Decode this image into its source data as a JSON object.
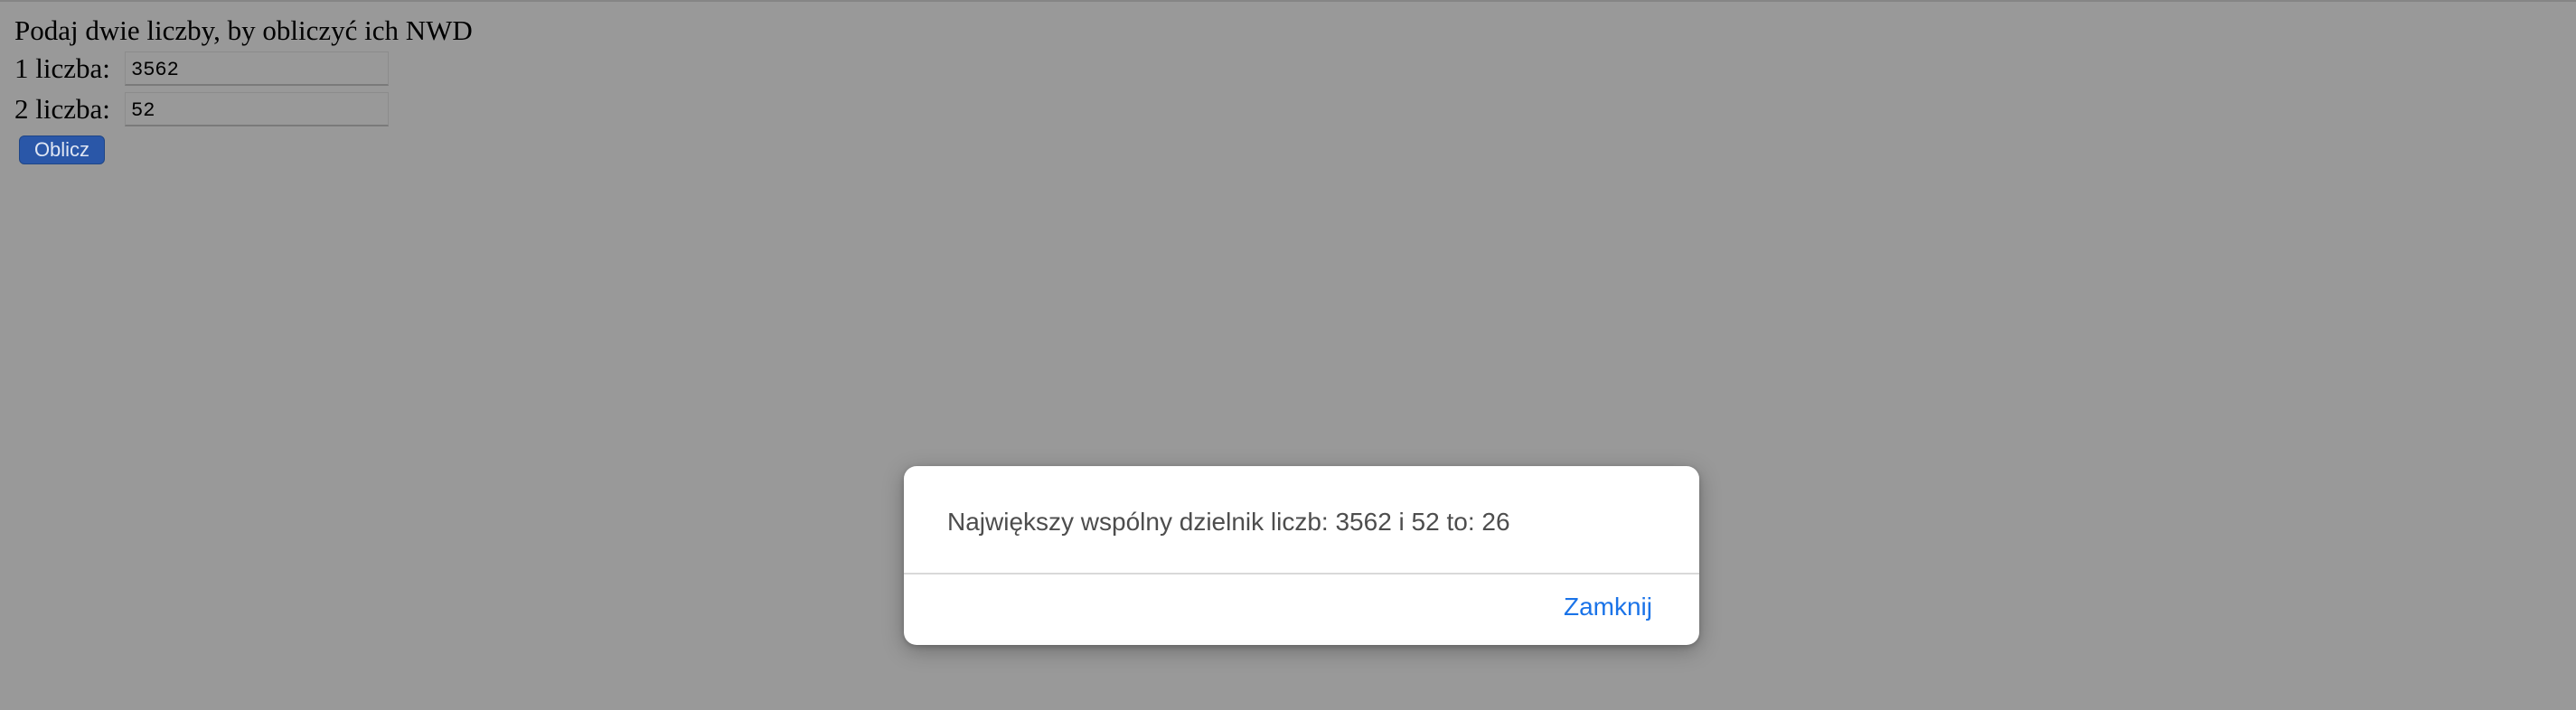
{
  "form": {
    "heading": "Podaj dwie liczby, by obliczyć ich NWD",
    "field1_label": "1 liczba:",
    "field1_value": "3562",
    "field2_label": "2 liczba:",
    "field2_value": "52",
    "submit_label": "Oblicz"
  },
  "dialog": {
    "message": "Największy wspólny dzielnik liczb: 3562 i 52 to: 26",
    "close_label": "Zamknij"
  },
  "colors": {
    "background": "#999999",
    "button": "#2a57a8",
    "link": "#1a73e8"
  }
}
